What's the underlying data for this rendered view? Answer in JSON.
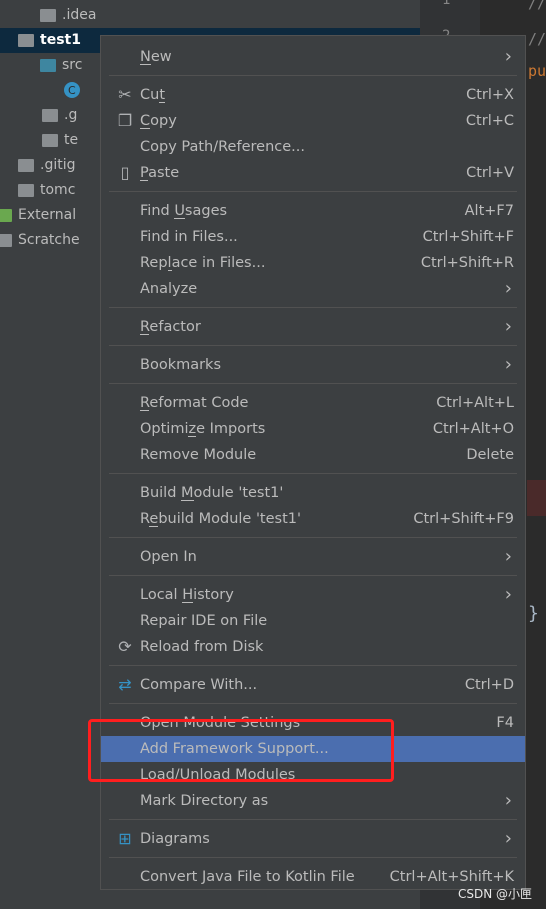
{
  "colors": {
    "selection": "#4b6eaf",
    "annotation": "#ff1e1e",
    "tree_selected": "#0d293e"
  },
  "tree": [
    {
      "label": ".idea",
      "arrow": "›",
      "icon": "folder-icon",
      "selected": false
    },
    {
      "label": "test1",
      "arrow": "⌄",
      "icon": "module-folder-icon",
      "selected": true
    },
    {
      "label": "src",
      "arrow": "⌄",
      "icon": "source-folder-icon",
      "selected": false
    },
    {
      "label": "C",
      "arrow": "",
      "icon": "java-class-icon",
      "selected": false
    },
    {
      "label": ".g",
      "arrow": "",
      "icon": "ignored-file-icon",
      "selected": false
    },
    {
      "label": "te",
      "arrow": "",
      "icon": "file-icon",
      "selected": false
    },
    {
      "label": ".gitig",
      "arrow": "",
      "icon": "ignored-file-icon",
      "selected": false
    },
    {
      "label": "tomc",
      "arrow": "",
      "icon": "file-icon",
      "selected": false
    },
    {
      "label": "External",
      "arrow": "›",
      "icon": "libraries-icon",
      "selected": false
    },
    {
      "label": "Scratche",
      "arrow": "›",
      "icon": "scratches-icon",
      "selected": false
    }
  ],
  "editor": {
    "line_numbers": [
      "1",
      "2"
    ],
    "code": [
      "//",
      "//",
      "pu",
      "}"
    ]
  },
  "menu": [
    {
      "label": "New",
      "mn": 0,
      "submenu": true
    },
    {
      "sep": true
    },
    {
      "label": "Cut",
      "mn": 2,
      "shortcut": "Ctrl+X",
      "icon": "scissors-icon"
    },
    {
      "label": "Copy",
      "mn": 0,
      "shortcut": "Ctrl+C",
      "icon": "copy-icon"
    },
    {
      "label": "Copy Path/Reference..."
    },
    {
      "label": "Paste",
      "mn": 0,
      "shortcut": "Ctrl+V",
      "icon": "clipboard-icon"
    },
    {
      "sep": true
    },
    {
      "label": "Find Usages",
      "mn": 5,
      "shortcut": "Alt+F7"
    },
    {
      "label": "Find in Files...",
      "shortcut": "Ctrl+Shift+F"
    },
    {
      "label": "Replace in Files...",
      "mn": 3,
      "shortcut": "Ctrl+Shift+R"
    },
    {
      "label": "Analyze",
      "submenu": true
    },
    {
      "sep": true
    },
    {
      "label": "Refactor",
      "mn": 0,
      "submenu": true
    },
    {
      "sep": true
    },
    {
      "label": "Bookmarks",
      "submenu": true
    },
    {
      "sep": true
    },
    {
      "label": "Reformat Code",
      "mn": 0,
      "shortcut": "Ctrl+Alt+L"
    },
    {
      "label": "Optimize Imports",
      "mn": 6,
      "shortcut": "Ctrl+Alt+O"
    },
    {
      "label": "Remove Module",
      "shortcut": "Delete"
    },
    {
      "sep": true
    },
    {
      "label": "Build Module 'test1'",
      "mn": 6
    },
    {
      "label": "Rebuild Module 'test1'",
      "mn": 1,
      "shortcut": "Ctrl+Shift+F9"
    },
    {
      "sep": true
    },
    {
      "label": "Open In",
      "submenu": true
    },
    {
      "sep": true
    },
    {
      "label": "Local History",
      "mn": 6,
      "submenu": true
    },
    {
      "label": "Repair IDE on File"
    },
    {
      "label": "Reload from Disk",
      "icon": "reload-icon"
    },
    {
      "sep": true
    },
    {
      "label": "Compare With...",
      "shortcut": "Ctrl+D",
      "icon": "compare-icon"
    },
    {
      "sep": true
    },
    {
      "label": "Open Module Settings",
      "shortcut": "F4"
    },
    {
      "label": "Add Framework Support...",
      "highlighted": true
    },
    {
      "label": "Load/Unload Modules"
    },
    {
      "label": "Mark Directory as",
      "submenu": true
    },
    {
      "sep": true
    },
    {
      "label": "Diagrams",
      "submenu": true,
      "icon": "diagram-icon"
    },
    {
      "sep": true
    },
    {
      "label": "Convert Java File to Kotlin File",
      "shortcut": "Ctrl+Alt+Shift+K"
    }
  ],
  "watermark": "CSDN @小匣"
}
